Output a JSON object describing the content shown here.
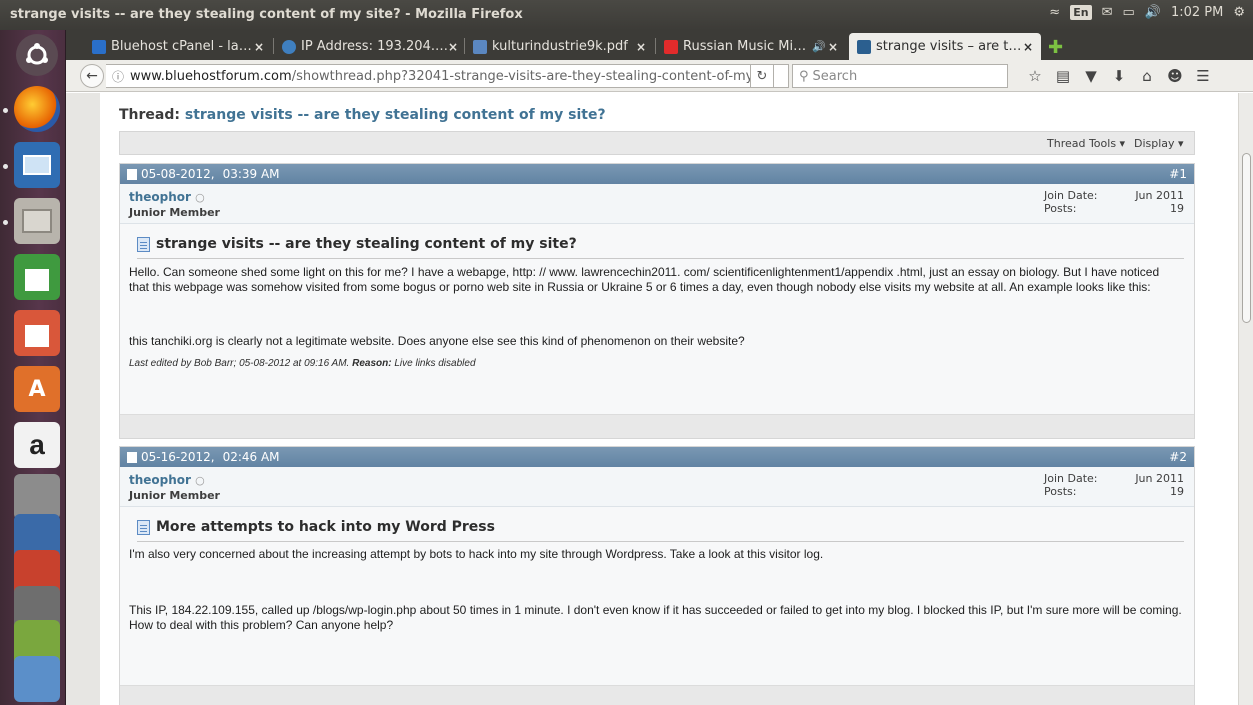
{
  "window": {
    "title": "strange visits -- are they stealing content of my site? - Mozilla Firefox"
  },
  "tray": {
    "lang": "En",
    "clock": "1:02 PM"
  },
  "tabs": [
    {
      "label": "Bluehost cPanel - la…",
      "close": "×",
      "color": "#2a6fc9"
    },
    {
      "label": "IP Address: 193.204.…",
      "close": "×",
      "color": "#3f7fbf"
    },
    {
      "label": "kulturindustrie9k.pdf",
      "close": "×",
      "color": "#5b87c0"
    },
    {
      "label": "Russian Music Mi…",
      "close": "×",
      "color": "#e22b2b"
    },
    {
      "label": "strange visits – are t…",
      "close": "×",
      "color": "#2b5f8f"
    }
  ],
  "navbar": {
    "url_domain": "www.bluehostforum.com",
    "url_path": "/showthread.php?32041-strange-visits-are-they-stealing-content-of-my-sit",
    "search_placeholder": "Search"
  },
  "thread": {
    "label": "Thread:",
    "title": "strange visits -- are they stealing content of my site?",
    "tools_label": "Thread Tools",
    "display_label": "Display"
  },
  "posts": [
    {
      "date": "05-08-2012,",
      "time": "03:39 AM",
      "number": "#1",
      "username": "theophor",
      "rank": "Junior Member",
      "join_label": "Join Date:",
      "join_value": "Jun 2011",
      "posts_label": "Posts:",
      "posts_value": "19",
      "title": "strange visits -- are they stealing content of my site?",
      "para1": "Hello. Can someone shed some light on this for me? I have a webapge, http: // www. lawrencechin2011. com/ scientificenlightenment1/appendix .html, just an essay on biology. But I have noticed that this webpage was somehow visited from some bogus or porno web site in Russia or Ukraine 5 or 6 times a day, even though nobody else visits my website at all. An example looks like this:",
      "para2": "this tanchiki.org is clearly not a legitimate website. Does anyone else see this kind of phenomenon on their website?",
      "edit_text": "Last edited by Bob Barr; 05-08-2012 at 09:16 AM.",
      "edit_reason_label": "Reason:",
      "edit_reason": "Live links disabled"
    },
    {
      "date": "05-16-2012,",
      "time": "02:46 AM",
      "number": "#2",
      "username": "theophor",
      "rank": "Junior Member",
      "join_label": "Join Date:",
      "join_value": "Jun 2011",
      "posts_label": "Posts:",
      "posts_value": "19",
      "title": "More attempts to hack into my Word Press",
      "para1": "I'm also very concerned about the increasing attempt by bots to hack into my site through Wordpress. Take a look at this visitor log.",
      "para2": "This IP, 184.22.109.155, called up /blogs/wp-login.php about 50 times in 1 minute. I don't even know if it has succeeded or failed to get into my blog. I blocked this IP, but I'm sure more will be coming. How to deal with this problem? Can anyone help?"
    }
  ]
}
